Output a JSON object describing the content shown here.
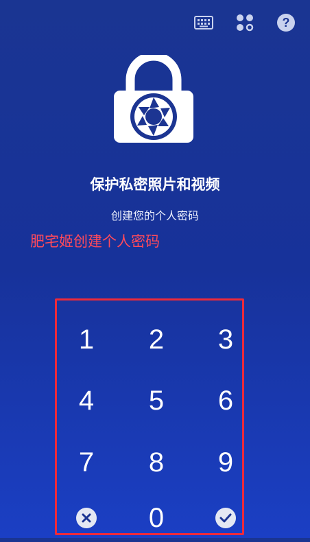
{
  "header": {
    "icons": [
      "keyboard-icon",
      "shuffle-icon",
      "help-icon"
    ]
  },
  "main": {
    "title": "保护私密照片和视频",
    "subtitle": "创建您的个人密码",
    "annotation": "肥宅姬创建个人密码"
  },
  "keypad": {
    "digits": [
      "1",
      "2",
      "3",
      "4",
      "5",
      "6",
      "7",
      "8",
      "9",
      "0"
    ],
    "clear_icon": "close-circle-icon",
    "confirm_icon": "check-circle-icon"
  },
  "colors": {
    "background_top": "#1a3592",
    "background_bottom": "#1b3fc4",
    "annotation": "#ff4a5b",
    "highlight_border": "#ee2a3a"
  }
}
